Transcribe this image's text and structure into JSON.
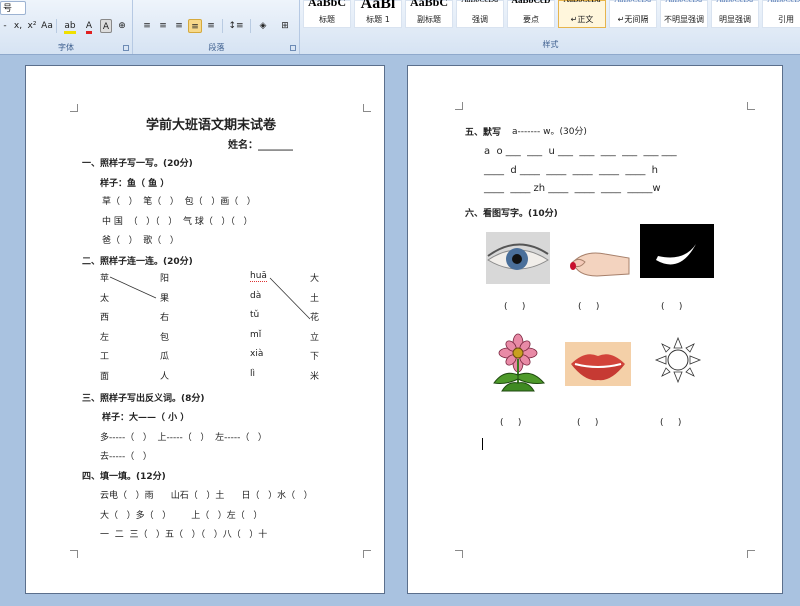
{
  "ribbon": {
    "font_group": {
      "label": "字体",
      "size": "号",
      "font_color_label": "A",
      "char_border": "A"
    },
    "paragraph_group": {
      "label": "段落"
    },
    "styles_group": {
      "label": "样式",
      "items": [
        {
          "preview": "AaBbC",
          "name": "标题"
        },
        {
          "preview": "AaBl",
          "name": "标题 1"
        },
        {
          "preview": "AaBbC",
          "name": "副标题"
        },
        {
          "preview": "AaBbCcDa",
          "name": "强调"
        },
        {
          "preview": "AaBbCcD",
          "name": "要点"
        },
        {
          "preview": "AaBbCcDa",
          "name": "↵正文"
        },
        {
          "preview": "AaBbCcDa",
          "name": "↵无间隔"
        },
        {
          "preview": "AaBbCcDa",
          "name": "不明显强调"
        },
        {
          "preview": "AaBbCcDa",
          "name": "明显强调"
        },
        {
          "preview": "AaBbCcDa",
          "name": "引用"
        }
      ]
    }
  },
  "page1": {
    "title": "学前大班语文期末试卷",
    "name_line": "姓名：_______",
    "s1_head": "一、照样子写一写。(20分)",
    "s1_example": "样子：鱼（ 鱼 ）",
    "s1_row1": "草（   ）  笔（   ）  包（   ）画（   ）",
    "s1_row2": "中 国  （   ）（   ）  气 球（   ）（   ）",
    "s1_row3": "爸（   ）  歌（   ）",
    "s2_head": "二、照样子连一连。(20分)",
    "s2_left": [
      "苹",
      "太",
      "西",
      "左",
      "工",
      "面"
    ],
    "s2_mid": [
      "阳",
      "果",
      "右",
      "包",
      "瓜",
      "人"
    ],
    "s2_py": [
      "huā",
      "dà",
      "tǔ",
      "mǐ",
      "xià",
      "lì"
    ],
    "s2_right": [
      "大",
      "土",
      "花",
      "立",
      "下",
      "米"
    ],
    "s3_head": "三、照样子写出反义词。(8分)",
    "s3_example": "样子：大——（ 小 ）",
    "s3_row1": "多-----（   ）  上-----（   ）  左-----（   ）",
    "s3_row2": "去-----（   ）",
    "s4_head": "四、填一填。(12分)",
    "s4_row1": "云电（   ）雨      山石（   ）土      日（   ）水（   ）",
    "s4_row2": "大（   ）多（   ）       上（   ）左（   ）",
    "s4_row3": "一  二  三（   ）五（   ）（   ）八（   ）十"
  },
  "page2": {
    "s5_head": "五、默写",
    "s5_head_rest": "a------- w。(30分)",
    "s5_row1": "a  o ___  ___  u ___  ___  ___  ___  ___ ___",
    "s5_row2": "____  d ____  ____  ____  ____  ____  h",
    "s5_row3": "____  ____ zh ____  ____  ____  _____w",
    "s6_head": "六、看图写字。(10分)",
    "paren_row1": [
      "(     )",
      "(     )",
      "(     )"
    ],
    "paren_row2": [
      "(     )",
      "(     )",
      "(     )"
    ]
  }
}
